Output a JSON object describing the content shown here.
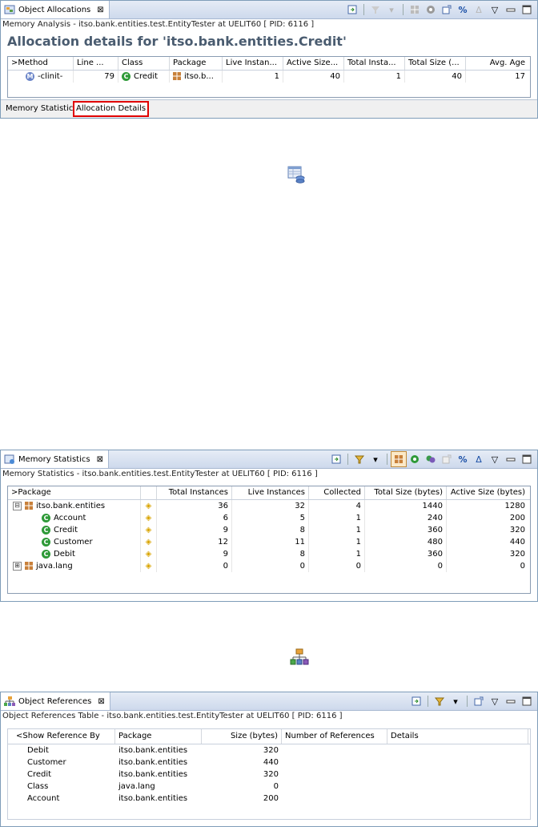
{
  "oa": {
    "tab_label": "Object Allocations",
    "close_glyph": "⊠",
    "subtitle": "Memory Analysis - itso.bank.entities.test.EntityTester at UELIT60 [ PID: 6116 ]",
    "heading": "Allocation details for 'itso.bank.entities.Credit'",
    "toolbar": {
      "percent": "%",
      "delta": "Δ",
      "menu": "▽",
      "minimize": "▭",
      "maximize": "▭"
    },
    "columns": [
      ">Method",
      "Line ...",
      "Class",
      "Package",
      "Live Instan...",
      "Active Size...",
      "Total Insta...",
      "Total Size (...",
      "Avg. Age"
    ],
    "row": {
      "method": "-clinit-",
      "line": "79",
      "class": "Credit",
      "package": "itso.b...",
      "live": "1",
      "active": "40",
      "total_inst": "1",
      "total_size": "40",
      "avg_age": "17"
    },
    "bottom_tabs": [
      "Memory Statistics",
      "Allocation Details"
    ]
  },
  "ms": {
    "tab_label": "Memory Statistics",
    "close_glyph": "⊠",
    "subtitle": "Memory Statistics - itso.bank.entities.test.EntityTester at UELIT60 [ PID: 6116 ]",
    "toolbar": {
      "percent": "%",
      "delta": "Δ",
      "menu": "▽"
    },
    "columns": [
      ">Package",
      "",
      "Total Instances",
      "Live Instances",
      "Collected",
      "Total Size (bytes)",
      "Active Size (bytes)"
    ],
    "rows": [
      {
        "kind": "pkg",
        "expander": "⊟",
        "name": "itso.bank.entities",
        "total": "36",
        "live": "32",
        "collected": "4",
        "size": "1440",
        "active": "1280"
      },
      {
        "kind": "cls",
        "name": "Account",
        "total": "6",
        "live": "5",
        "collected": "1",
        "size": "240",
        "active": "200"
      },
      {
        "kind": "cls",
        "name": "Credit",
        "total": "9",
        "live": "8",
        "collected": "1",
        "size": "360",
        "active": "320"
      },
      {
        "kind": "cls",
        "name": "Customer",
        "total": "12",
        "live": "11",
        "collected": "1",
        "size": "480",
        "active": "440"
      },
      {
        "kind": "cls",
        "name": "Debit",
        "total": "9",
        "live": "8",
        "collected": "1",
        "size": "360",
        "active": "320"
      },
      {
        "kind": "pkg",
        "expander": "⊞",
        "name": "java.lang",
        "total": "0",
        "live": "0",
        "collected": "0",
        "size": "0",
        "active": "0"
      }
    ]
  },
  "or": {
    "tab_label": "Object References",
    "close_glyph": "⊠",
    "subtitle": "Object References Table - itso.bank.entities.test.EntityTester at UELIT60 [ PID: 6116 ]",
    "toolbar": {
      "menu": "▽"
    },
    "columns": [
      "<Show Reference By",
      "Package",
      "Size (bytes)",
      "Number of References",
      "Details"
    ],
    "rows": [
      {
        "name": "Debit",
        "package": "itso.bank.entities",
        "size": "320"
      },
      {
        "name": "Customer",
        "package": "itso.bank.entities",
        "size": "440"
      },
      {
        "name": "Credit",
        "package": "itso.bank.entities",
        "size": "320"
      },
      {
        "name": "Class",
        "package": "java.lang",
        "size": "0"
      },
      {
        "name": "Account",
        "package": "itso.bank.entities",
        "size": "200"
      }
    ]
  },
  "glyphs": {
    "class_icon": "C",
    "method_icon": "M",
    "diamond": "◈",
    "blank": ""
  }
}
